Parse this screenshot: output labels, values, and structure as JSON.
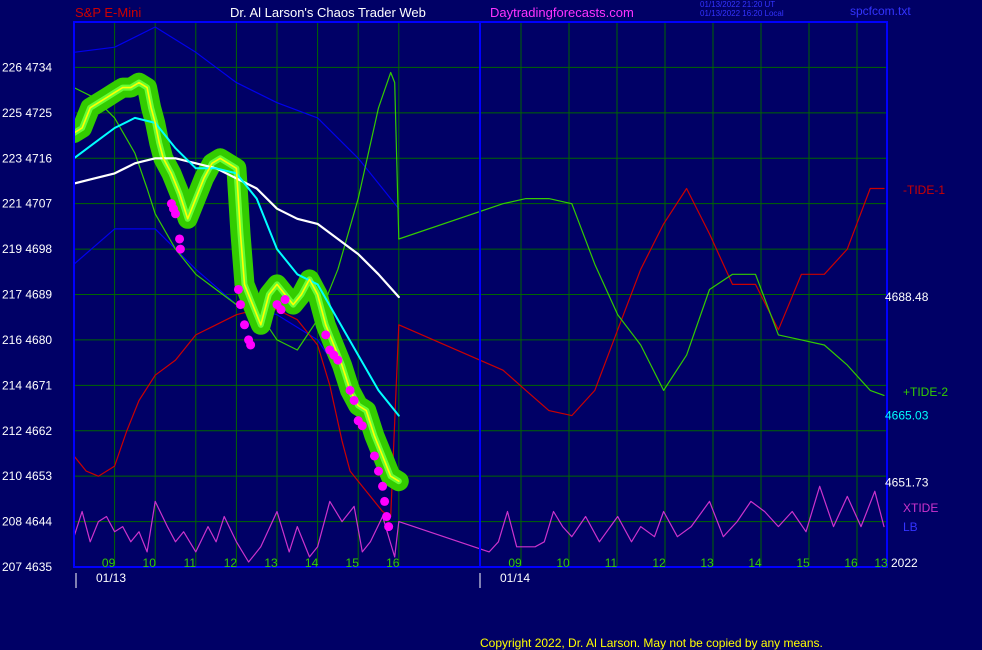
{
  "header": {
    "symbol": "S&P E-Mini",
    "site_title": "Dr. Al Larson's Chaos Trader Web",
    "url": "Daytradingforecasts.com",
    "timestamp_line1": "01/13/2022 21:20 UT",
    "timestamp_line2": "01/13/2022 16:20 Local",
    "file_name": "spcfcom.txt"
  },
  "footer": {
    "copyright": "Copyright 2022, Dr. Al Larson. May not be copied by any means."
  },
  "colors": {
    "background": "#000066",
    "frame": "#0000ff",
    "grid": "#006600",
    "price": "#ffff00",
    "price_band": "#33cc00",
    "band_dots": "#ff00ff",
    "ma_fast": "#00ffff",
    "ma_slow": "#ffffff",
    "channel": "#0000ee",
    "tide_minus_1": "#cc0000",
    "tide_plus_2": "#33cc00",
    "xtide": "#cc33cc",
    "lb": "#3333ff"
  },
  "chart_data": {
    "type": "line",
    "title": "S&P E-Mini",
    "y_left_labels": [
      {
        "text": "226 4734",
        "value": 4734
      },
      {
        "text": "225 4725",
        "value": 4725
      },
      {
        "text": "223 4716",
        "value": 4716
      },
      {
        "text": "221 4707",
        "value": 4707
      },
      {
        "text": "219 4698",
        "value": 4698
      },
      {
        "text": "217 4689",
        "value": 4689
      },
      {
        "text": "216 4680",
        "value": 4680
      },
      {
        "text": "214 4671",
        "value": 4671
      },
      {
        "text": "212 4662",
        "value": 4662
      },
      {
        "text": "210 4653",
        "value": 4653
      },
      {
        "text": "208 4644",
        "value": 4644
      },
      {
        "text": "207 4635",
        "value": 4635
      }
    ],
    "ylim": [
      4635,
      4743
    ],
    "xlim": [
      8,
      18
    ],
    "x_ticks": [
      {
        "label": "09",
        "x": 9
      },
      {
        "label": "10",
        "x": 10
      },
      {
        "label": "11",
        "x": 11
      },
      {
        "label": "12",
        "x": 12
      },
      {
        "label": "13",
        "x": 13
      },
      {
        "label": "14",
        "x": 14
      },
      {
        "label": "15",
        "x": 15
      },
      {
        "label": "16",
        "x": 16
      }
    ],
    "forecast_ticks": [
      {
        "label": "09",
        "x": 9
      },
      {
        "label": "10",
        "x": 10
      },
      {
        "label": "11",
        "x": 11
      },
      {
        "label": "12",
        "x": 12
      },
      {
        "label": "13",
        "x": 13
      },
      {
        "label": "14",
        "x": 14
      },
      {
        "label": "15",
        "x": 15
      },
      {
        "label": "16",
        "x": 16
      }
    ],
    "forecast_label_truncated": "13",
    "date_labels": [
      {
        "label": "01/13",
        "x": 8.5
      },
      {
        "label": "01/14",
        "x": 16.7
      }
    ],
    "year_label": "2022",
    "right_value_labels": [
      {
        "text": "4688.48",
        "value": 4688.48,
        "color": "#ffffff"
      },
      {
        "text": "4665.03",
        "value": 4665.03,
        "color": "#00ffff"
      },
      {
        "text": "4651.73",
        "value": 4651.73,
        "color": "#ffffff"
      }
    ],
    "legend": [
      {
        "name": "-TIDE-1",
        "color": "#cc0000"
      },
      {
        "name": "+TIDE-2",
        "color": "#33cc00"
      },
      {
        "name": "XTIDE",
        "color": "#cc33cc"
      },
      {
        "name": "LB",
        "color": "#3333ff"
      }
    ],
    "grid": true,
    "series": [
      {
        "key": "price",
        "x": [
          8,
          8.2,
          8.4,
          8.6,
          8.8,
          9,
          9.2,
          9.4,
          9.6,
          9.8,
          9.9,
          10,
          10.1,
          10.2,
          10.4,
          10.6,
          10.8,
          11,
          11.2,
          11.4,
          11.6,
          11.8,
          12,
          12.1,
          12.2,
          12.4,
          12.6,
          12.8,
          13,
          13.2,
          13.4,
          13.6,
          13.8,
          14,
          14.2,
          14.4,
          14.6,
          14.8,
          15,
          15.2,
          15.4,
          15.6,
          15.8,
          16
        ],
        "values": [
          4721,
          4722,
          4726,
          4727,
          4728,
          4729,
          4730,
          4730,
          4731,
          4730,
          4726,
          4723,
          4719,
          4716,
          4713,
          4709,
          4704,
          4708,
          4712,
          4715,
          4716,
          4715,
          4714,
          4701,
          4691,
          4687,
          4683,
          4689,
          4691,
          4689,
          4687,
          4689,
          4692,
          4689,
          4683,
          4679,
          4675,
          4670,
          4667,
          4666,
          4661,
          4657,
          4653,
          4652
        ]
      },
      {
        "key": "ma_fast",
        "x": [
          8,
          8.5,
          9,
          9.5,
          10,
          10.5,
          11,
          11.5,
          12,
          12.5,
          13,
          13.5,
          14,
          14.5,
          15,
          15.5,
          16
        ],
        "values": [
          4716,
          4719,
          4722,
          4724,
          4723,
          4718,
          4714,
          4714,
          4713,
          4708,
          4698,
          4693,
          4691,
          4684,
          4677,
          4670,
          4665
        ]
      },
      {
        "key": "ma_slow",
        "x": [
          8,
          8.5,
          9,
          9.5,
          10,
          10.5,
          11,
          11.5,
          12,
          12.5,
          13,
          13.5,
          14,
          14.5,
          15,
          15.5,
          16
        ],
        "values": [
          4711,
          4712,
          4713,
          4715,
          4716,
          4716,
          4715,
          4714,
          4712,
          4710,
          4706,
          4704,
          4703,
          4700,
          4697,
          4693,
          4688.5
        ]
      },
      {
        "key": "channel_upper",
        "x": [
          8,
          9,
          10,
          11,
          12,
          13,
          14,
          15,
          16
        ],
        "values": [
          4737,
          4738,
          4742,
          4737,
          4731,
          4727,
          4724,
          4716,
          4706
        ]
      },
      {
        "key": "channel_lower",
        "x": [
          8,
          9,
          10,
          11,
          12,
          13,
          14,
          15,
          16
        ],
        "values": [
          4695,
          4702,
          4702,
          4694,
          4687,
          4685,
          4680,
          4668,
          4652
        ]
      },
      {
        "key": "tide_minus_1",
        "x": [
          8,
          8.3,
          8.6,
          9,
          9.3,
          9.6,
          10,
          10.5,
          11,
          11.5,
          12,
          12.5,
          13,
          13.5,
          14,
          14.3,
          14.6,
          14.8,
          15,
          15.3,
          15.6,
          15.8,
          16,
          16.5,
          17,
          17.5,
          18,
          18.5,
          19,
          19.5,
          20,
          20.5,
          21,
          21.5,
          22,
          22.5,
          23,
          23.5,
          24,
          24.5,
          24.8
        ],
        "values": [
          4657,
          4654,
          4653,
          4655,
          4662,
          4668,
          4673,
          4676,
          4681,
          4683,
          4685,
          4686,
          4686,
          4684,
          4679,
          4671,
          4660,
          4654,
          4652,
          4649,
          4646,
          4645,
          4683,
          4674,
          4670,
          4666,
          4665,
          4670,
          4682,
          4694,
          4703,
          4710,
          4701,
          4691,
          4691,
          4682,
          4693,
          4693,
          4698,
          4710,
          4710
        ]
      },
      {
        "key": "tide_plus_2",
        "x": [
          8,
          8.5,
          9,
          9.5,
          9.8,
          10,
          10.5,
          11,
          11.5,
          12,
          12.5,
          13,
          13.5,
          14,
          14.5,
          15,
          15.5,
          15.8,
          15.9,
          16,
          16.5,
          17,
          17.5,
          18,
          18.5,
          19,
          19.5,
          20,
          20.5,
          21,
          21.5,
          22,
          22.5,
          23,
          23.5,
          24,
          24.5,
          24.8
        ],
        "values": [
          4730,
          4728,
          4724,
          4717,
          4710,
          4705,
          4698,
          4693,
          4690,
          4687,
          4686,
          4680,
          4678,
          4684,
          4694,
          4708,
          4726,
          4733,
          4731,
          4700,
          4707,
          4708,
          4708,
          4707,
          4695,
          4685,
          4679,
          4670,
          4677,
          4690,
          4693,
          4693,
          4681,
          4680,
          4679,
          4675,
          4670,
          4669
        ]
      },
      {
        "key": "xtide",
        "x": [
          8,
          8.2,
          8.4,
          8.6,
          8.8,
          9,
          9.2,
          9.4,
          9.6,
          9.8,
          10,
          10.3,
          10.5,
          10.7,
          11,
          11.3,
          11.5,
          11.7,
          12,
          12.3,
          12.6,
          13,
          13.3,
          13.5,
          13.8,
          14,
          14.3,
          14.6,
          14.9,
          15.1,
          15.3,
          15.6,
          15.9,
          16,
          16.2,
          16.4,
          16.6,
          16.8,
          17,
          17.2,
          17.4,
          17.6,
          17.8,
          18,
          18.3,
          18.6,
          19,
          19.3,
          19.5,
          19.8,
          20,
          20.3,
          20.6,
          21,
          21.3,
          21.6,
          21.9,
          22.2,
          22.5,
          22.8,
          23.1,
          23.4,
          23.7,
          24,
          24.3,
          24.6,
          24.8
        ],
        "values": [
          4641,
          4646,
          4640,
          4644,
          4645,
          4642,
          4643,
          4640,
          4642,
          4638,
          4648,
          4643,
          4640,
          4642,
          4638,
          4643,
          4640,
          4645,
          4640,
          4636,
          4639,
          4646,
          4638,
          4643,
          4637,
          4639,
          4648,
          4644,
          4647,
          4638,
          4640,
          4645,
          4637,
          4644,
          4638,
          4640,
          4646,
          4639,
          4639,
          4639,
          4640,
          4646,
          4643,
          4641,
          4645,
          4640,
          4645,
          4640,
          4643,
          4641,
          4646,
          4641,
          4643,
          4648,
          4641,
          4644,
          4648,
          4646,
          4643,
          4646,
          4642,
          4651,
          4643,
          4649,
          4643,
          4650,
          4643
        ]
      }
    ],
    "band_dots": [
      {
        "x": 10.4,
        "y": 4707
      },
      {
        "x": 10.45,
        "y": 4706
      },
      {
        "x": 10.5,
        "y": 4705
      },
      {
        "x": 10.6,
        "y": 4700
      },
      {
        "x": 10.62,
        "y": 4698
      },
      {
        "x": 12.05,
        "y": 4690
      },
      {
        "x": 12.1,
        "y": 4687
      },
      {
        "x": 12.2,
        "y": 4683
      },
      {
        "x": 12.3,
        "y": 4680
      },
      {
        "x": 12.35,
        "y": 4679
      },
      {
        "x": 13.0,
        "y": 4687
      },
      {
        "x": 13.1,
        "y": 4686
      },
      {
        "x": 13.2,
        "y": 4688
      },
      {
        "x": 14.2,
        "y": 4681
      },
      {
        "x": 14.3,
        "y": 4678
      },
      {
        "x": 14.4,
        "y": 4677
      },
      {
        "x": 14.5,
        "y": 4676
      },
      {
        "x": 14.8,
        "y": 4670
      },
      {
        "x": 14.9,
        "y": 4668
      },
      {
        "x": 15.0,
        "y": 4664
      },
      {
        "x": 15.1,
        "y": 4663
      },
      {
        "x": 15.4,
        "y": 4657
      },
      {
        "x": 15.5,
        "y": 4654
      },
      {
        "x": 15.6,
        "y": 4651
      },
      {
        "x": 15.65,
        "y": 4648
      },
      {
        "x": 15.7,
        "y": 4645
      },
      {
        "x": 15.75,
        "y": 4643
      }
    ]
  }
}
